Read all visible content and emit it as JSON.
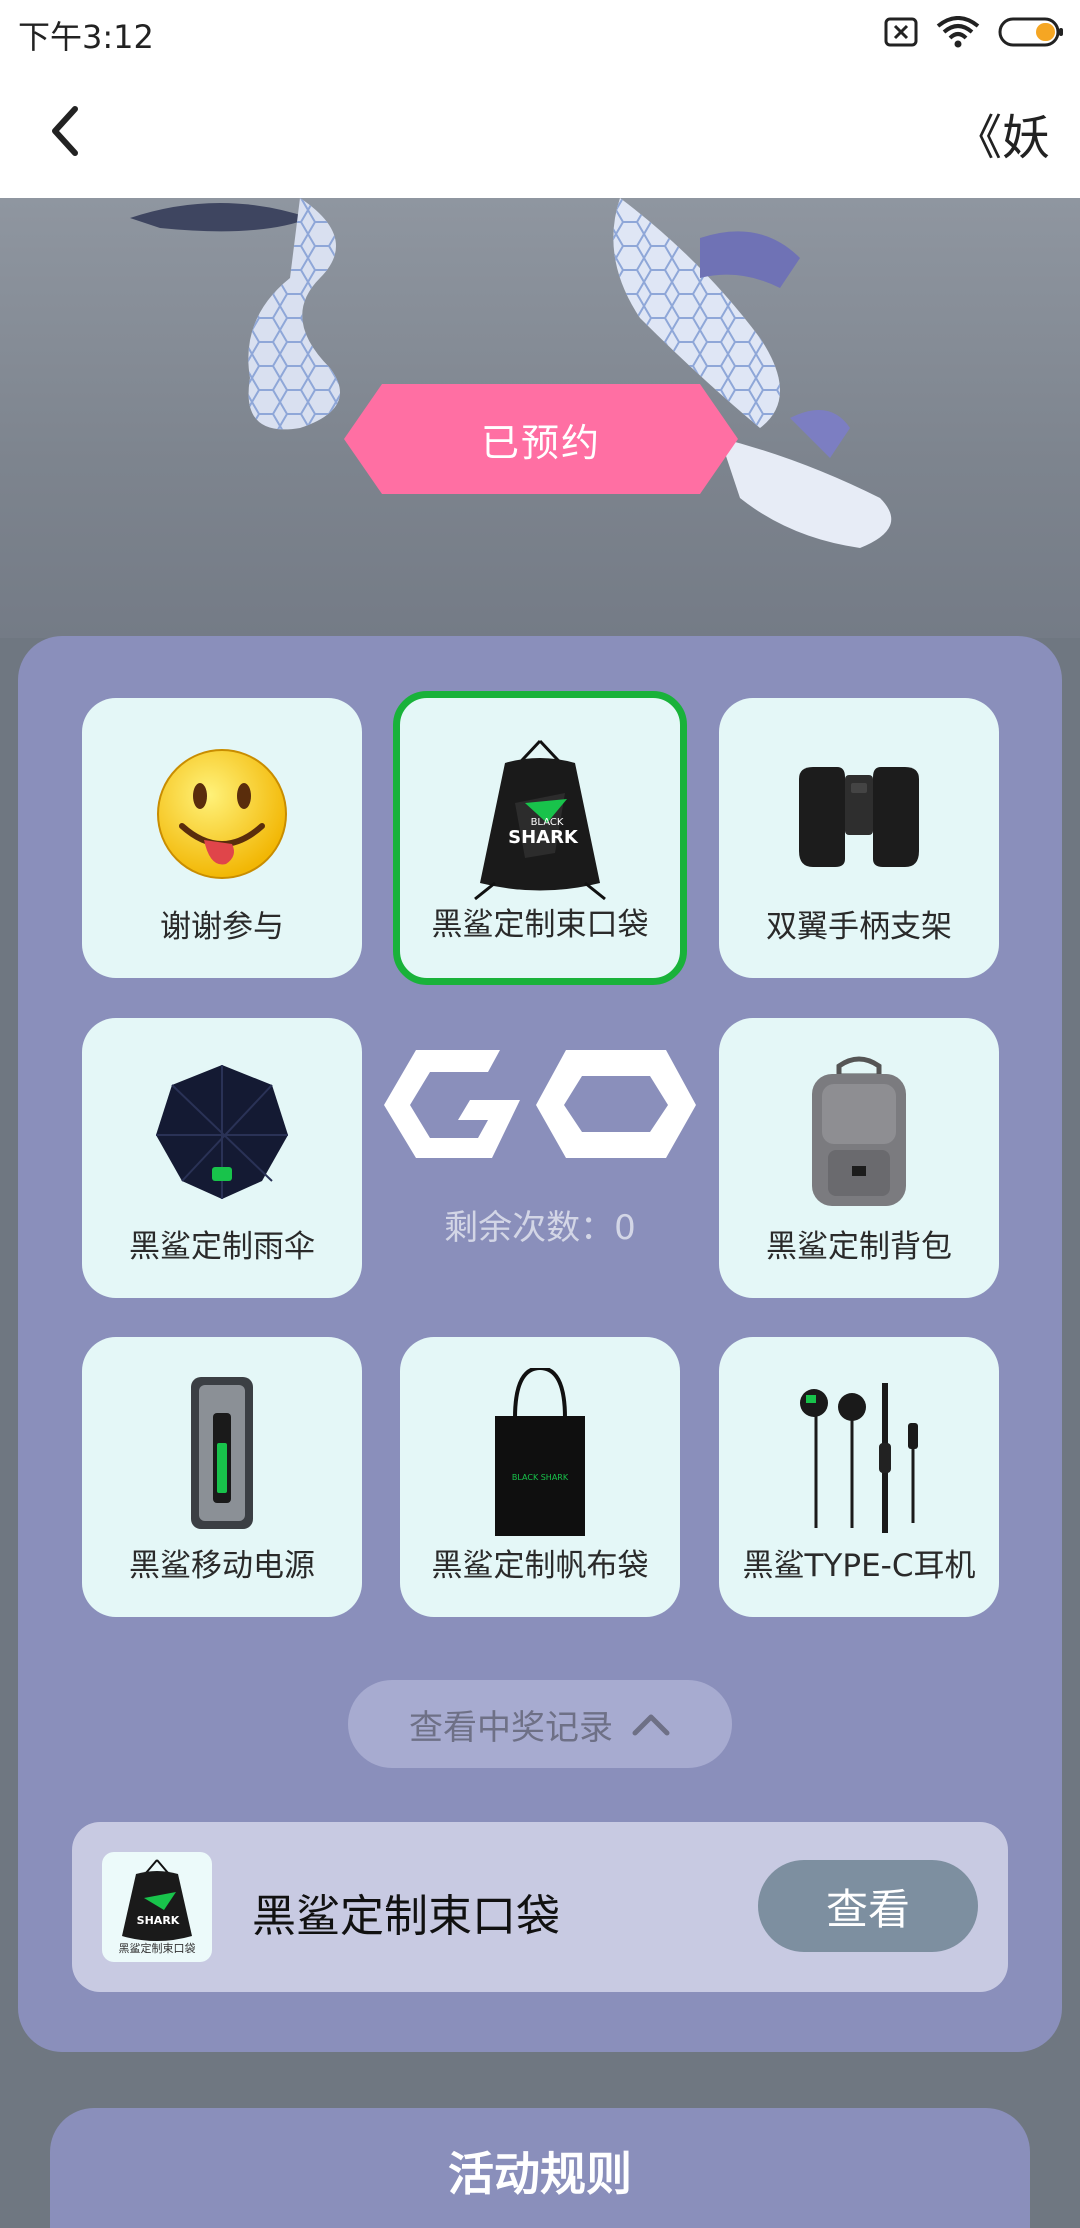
{
  "status_bar": {
    "time": "下午3:12"
  },
  "header": {
    "title": "《妖"
  },
  "hero": {
    "reserve_label": "已预约"
  },
  "prizes": [
    {
      "label": "谢谢参与",
      "icon": "smiley-tongue-icon",
      "selected": false
    },
    {
      "label": "黑鲨定制束口袋",
      "icon": "drawstring-bag-icon",
      "selected": true
    },
    {
      "label": "双翼手柄支架",
      "icon": "gamepad-holder-icon",
      "selected": false
    },
    {
      "label": "黑鲨定制雨伞",
      "icon": "umbrella-icon",
      "selected": false
    },
    {
      "label": "黑鲨定制背包",
      "icon": "backpack-icon",
      "selected": false
    },
    {
      "label": "黑鲨移动电源",
      "icon": "power-bank-icon",
      "selected": false
    },
    {
      "label": "黑鲨定制帆布袋",
      "icon": "tote-bag-icon",
      "selected": false
    },
    {
      "label": "黑鲨TYPE-C耳机",
      "icon": "earphones-icon",
      "selected": false
    }
  ],
  "draw": {
    "go_label": "GO",
    "remaining_text": "剩余次数：0"
  },
  "records": {
    "button_label": "查看中奖记录"
  },
  "latest_prize": {
    "name": "黑鲨定制束口袋",
    "thumb_caption": "黑鲨定制束口袋",
    "view_label": "查看"
  },
  "rules": {
    "title": "活动规则"
  },
  "colors": {
    "accent_pink": "#ff6fa3",
    "selected_border": "#19b23a",
    "panel": "#8a8fbb",
    "card": "#e4f7f7"
  }
}
